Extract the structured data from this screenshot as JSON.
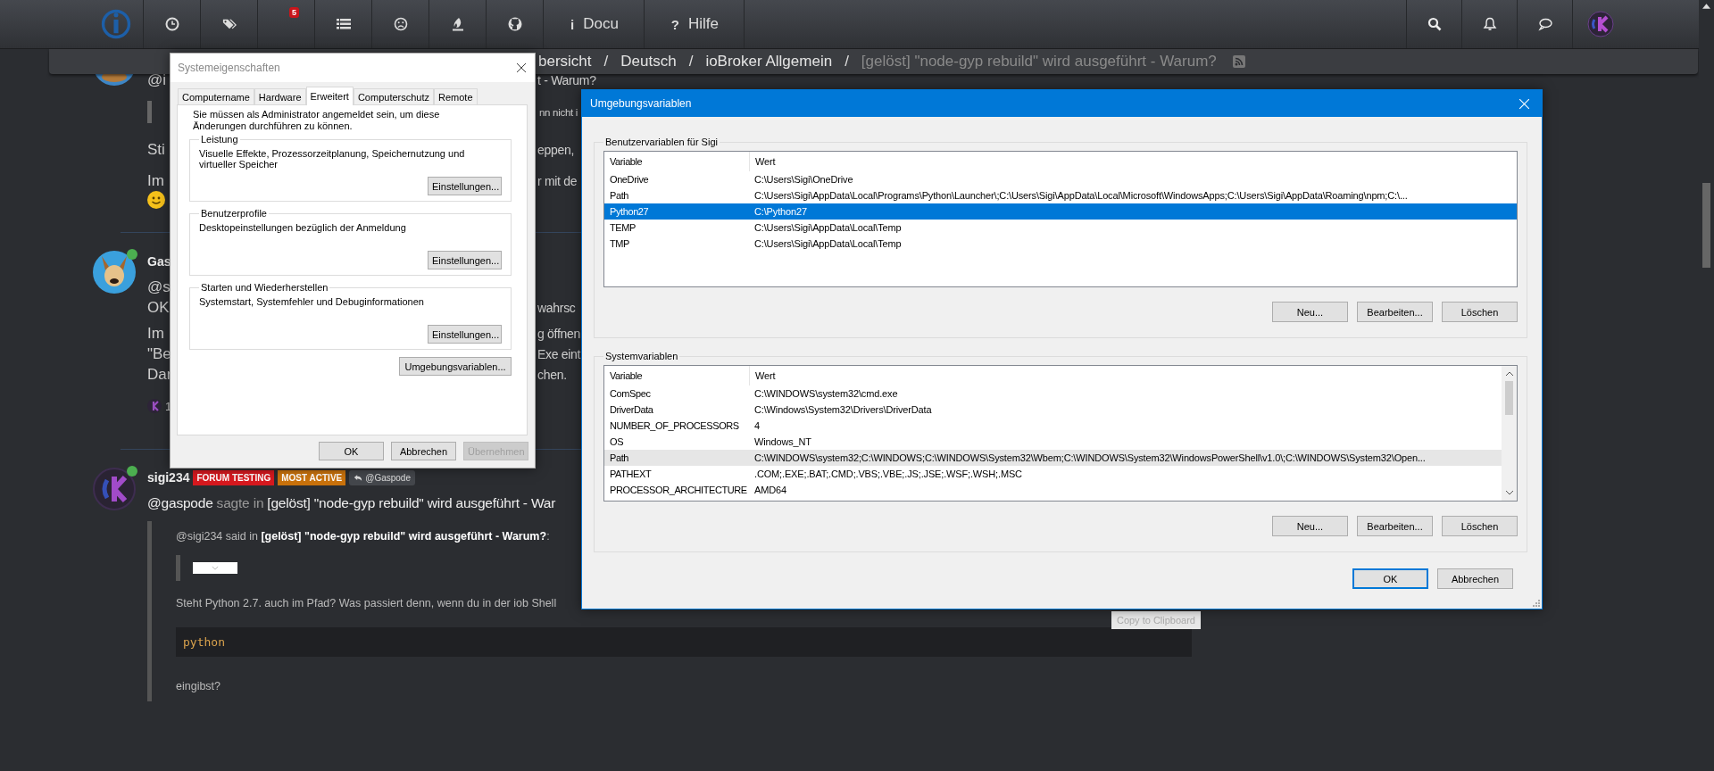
{
  "nav": {
    "items": [
      {
        "kind": "logo"
      },
      {
        "kind": "clock"
      },
      {
        "kind": "tags"
      },
      {
        "kind": "inbox",
        "badge": "5"
      },
      {
        "kind": "list"
      },
      {
        "kind": "frown"
      },
      {
        "kind": "flame"
      },
      {
        "kind": "github"
      },
      {
        "kind": "text",
        "glyph": "i",
        "label": "Docu"
      },
      {
        "kind": "text",
        "glyph": "?",
        "label": "Hilfe"
      }
    ],
    "right": [
      {
        "kind": "search"
      },
      {
        "kind": "bell"
      },
      {
        "kind": "chat"
      },
      {
        "kind": "avatar"
      }
    ]
  },
  "breadcrumb": [
    {
      "kind": "link",
      "text": "bersicht"
    },
    {
      "kind": "sep",
      "text": "/"
    },
    {
      "kind": "link",
      "text": "Deutsch"
    },
    {
      "kind": "sep",
      "text": "/"
    },
    {
      "kind": "link",
      "text": "ioBroker Allgemein"
    },
    {
      "kind": "sep",
      "text": "/"
    },
    {
      "kind": "current",
      "text": "[gelöst] \"node-gyp rebuild\" wird ausgeführt - Warum?"
    },
    {
      "kind": "rss"
    }
  ],
  "post_1": {
    "blocks": [
      {
        "kind": "para",
        "lines": [
          {
            "kind": "text",
            "left": "@i",
            "right": "t - Warum?"
          }
        ]
      },
      {
        "kind": "quote",
        "lines": [
          {
            "kind": "text",
            "right": "nn nicht i"
          }
        ]
      },
      {
        "kind": "para",
        "lines": [
          {
            "kind": "text",
            "left": "Sti",
            "right": "eppen,"
          }
        ]
      },
      {
        "kind": "para",
        "lines": [
          {
            "kind": "text",
            "left": "Im",
            "right": "r mit de"
          },
          {
            "kind": "emoji"
          }
        ]
      }
    ]
  },
  "post_2": {
    "author": "Gas",
    "online": true,
    "blocks": [
      {
        "kind": "para",
        "lines": [
          {
            "kind": "text",
            "left": "@s"
          },
          {
            "kind": "text",
            "left": "OK",
            "right": "wahrsc"
          }
        ]
      },
      {
        "kind": "para",
        "lines": [
          {
            "kind": "text",
            "left": "Im",
            "right": "g öffnen"
          },
          {
            "kind": "text",
            "left": "\"Be",
            "right": "Exe eint"
          },
          {
            "kind": "text",
            "left": "Dar",
            "right": "chen."
          }
        ]
      }
    ],
    "votes": "1"
  },
  "post_3": {
    "author": "sigi234",
    "online": true,
    "badges": [
      {
        "label": "FORUM TESTING",
        "color": "#d6191f"
      },
      {
        "label": "MOST ACTIVE",
        "color": "#c9720c"
      }
    ],
    "reply_to": "@Gaspode",
    "mention": "@gaspode",
    "said": "sagte in",
    "topic": "[gelöst] \"node-gyp rebuild\" wird ausgeführt - War",
    "quote": {
      "header": "@sigi234 said in **[gelöst] \"node-gyp rebuild\" wird ausgeführt - Warum?**:",
      "question": "Steht Python 2.7. auch im Pfad? Was passiert denn, wenn du in der iob Shell",
      "copy_button": "Copy to Clipboard",
      "code": "python",
      "after": "eingibst?"
    }
  },
  "system_properties": {
    "title": "Systemeigenschaften",
    "tabs": [
      {
        "label": "Computername",
        "selected": false
      },
      {
        "label": "Hardware",
        "selected": false
      },
      {
        "label": "Erweitert",
        "selected": true
      },
      {
        "label": "Computerschutz",
        "selected": false
      },
      {
        "label": "Remote",
        "selected": false
      }
    ],
    "notice": "Sie müssen als Administrator angemeldet sein, um diese Änderungen durchführen zu können.",
    "groups": [
      {
        "title": "Leistung",
        "description": "Visuelle Effekte, Prozessorzeitplanung, Speichernutzung und virtueller Speicher",
        "button": "Einstellungen..."
      },
      {
        "title": "Benutzerprofile",
        "description": "Desktopeinstellungen bezüglich der Anmeldung",
        "button": "Einstellungen..."
      },
      {
        "title": "Starten und Wiederherstellen",
        "description": "Systemstart, Systemfehler und Debuginformationen",
        "button": "Einstellungen..."
      }
    ],
    "env_button": "Umgebungsvariablen...",
    "buttons": [
      {
        "label": "OK",
        "disabled": false
      },
      {
        "label": "Abbrechen",
        "disabled": false
      },
      {
        "label": "Übernehmen",
        "disabled": true
      }
    ]
  },
  "environment_variables": {
    "title": "Umgebungsvariablen",
    "lists": [
      {
        "title": "Benutzervariablen für Sigi",
        "focused": true,
        "scrollbar": false,
        "columns": [
          "Variable",
          "Wert"
        ],
        "rows": [
          {
            "variable": "OneDrive",
            "value": "C:\\Users\\Sigi\\OneDrive",
            "selected": false
          },
          {
            "variable": "Path",
            "value": "C:\\Users\\Sigi\\AppData\\Local\\Programs\\Python\\Launcher\\;C:\\Users\\Sigi\\AppData\\Local\\Microsoft\\WindowsApps;C:\\Users\\Sigi\\AppData\\Roaming\\npm;C:\\...",
            "selected": false
          },
          {
            "variable": "Python27",
            "value": "C:\\Python27",
            "selected": true
          },
          {
            "variable": "TEMP",
            "value": "C:\\Users\\Sigi\\AppData\\Local\\Temp",
            "selected": false
          },
          {
            "variable": "TMP",
            "value": "C:\\Users\\Sigi\\AppData\\Local\\Temp",
            "selected": false
          }
        ],
        "buttons": [
          "Neu...",
          "Bearbeiten...",
          "Löschen"
        ]
      },
      {
        "title": "Systemvariablen",
        "focused": false,
        "scrollbar": true,
        "columns": [
          "Variable",
          "Wert"
        ],
        "rows": [
          {
            "variable": "ComSpec",
            "value": "C:\\WINDOWS\\system32\\cmd.exe",
            "selected": false
          },
          {
            "variable": "DriverData",
            "value": "C:\\Windows\\System32\\Drivers\\DriverData",
            "selected": false
          },
          {
            "variable": "NUMBER_OF_PROCESSORS",
            "value": "4",
            "selected": false
          },
          {
            "variable": "OS",
            "value": "Windows_NT",
            "selected": false
          },
          {
            "variable": "Path",
            "value": "C:\\WINDOWS\\system32;C:\\WINDOWS;C:\\WINDOWS\\System32\\Wbem;C:\\WINDOWS\\System32\\WindowsPowerShell\\v1.0\\;C:\\WINDOWS\\System32\\Open...",
            "selected": true
          },
          {
            "variable": "PATHEXT",
            "value": ".COM;.EXE;.BAT;.CMD;.VBS;.VBE;.JS;.JSE;.WSF;.WSH;.MSC",
            "selected": false
          },
          {
            "variable": "PROCESSOR_ARCHITECTURE",
            "value": "AMD64",
            "selected": false
          }
        ],
        "buttons": [
          "Neu...",
          "Bearbeiten...",
          "Löschen"
        ]
      }
    ],
    "buttons": [
      {
        "label": "OK",
        "default": true
      },
      {
        "label": "Abbrechen",
        "default": false
      }
    ]
  }
}
